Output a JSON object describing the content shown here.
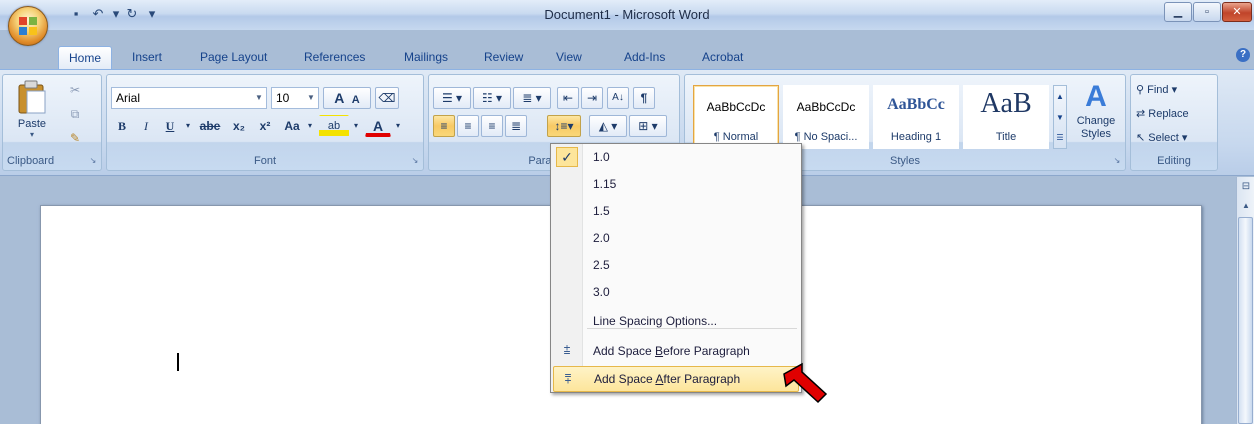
{
  "window": {
    "title": "Document1 - Microsoft Word"
  },
  "tabs": [
    "Home",
    "Insert",
    "Page Layout",
    "References",
    "Mailings",
    "Review",
    "View",
    "Add-Ins",
    "Acrobat"
  ],
  "clipboard": {
    "paste_label": "Paste",
    "group_label": "Clipboard"
  },
  "font": {
    "name": "Arial",
    "size": "10",
    "group_label": "Font",
    "bold": "B",
    "italic": "I",
    "underline": "U",
    "strike": "abe",
    "subscript": "x₂",
    "superscript": "x²",
    "change_case": "Aa",
    "grow": "A",
    "shrink": "A",
    "highlight": "ab",
    "font_color": "A"
  },
  "paragraph": {
    "group_label": "Paragraph"
  },
  "styles": {
    "group_label": "Styles",
    "change_label": "Change Styles",
    "items": [
      {
        "sample": "AaBbCcDc",
        "name": "¶ Normal"
      },
      {
        "sample": "AaBbCcDc",
        "name": "¶ No Spaci..."
      },
      {
        "sample": "AaBbCc",
        "name": "Heading 1"
      },
      {
        "sample": "AaB",
        "name": "Title"
      }
    ]
  },
  "editing": {
    "group_label": "Editing",
    "find": "Find",
    "replace": "Replace",
    "select": "Select"
  },
  "dropdown": {
    "checked_mark": "✓",
    "items": [
      "1.0",
      "1.15",
      "1.5",
      "2.0",
      "2.5",
      "3.0",
      "Line Spacing Options..."
    ],
    "before_prefix": "Add Space ",
    "before_underline": "B",
    "before_suffix": "efore Paragraph",
    "after_prefix": "Add Space ",
    "after_underline": "A",
    "after_suffix": "fter Paragraph"
  },
  "colors": {
    "accent": "#15428b",
    "highlight": "#fde59b",
    "arrow": "#e00000"
  }
}
